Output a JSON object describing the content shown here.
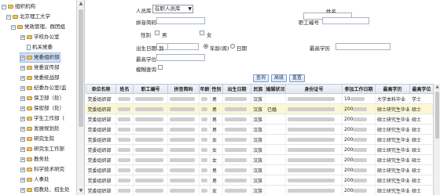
{
  "tree": {
    "root": "组织机构",
    "school": "北京理工大学",
    "college": "党政管理、群团组",
    "items": [
      "学校办公室",
      "机关党委",
      "党委组织部",
      "党委宣传部",
      "党委统战部",
      "纪委办公室(监",
      "保卫部（处）",
      "保密部（处）",
      "学生工作部（",
      "发展规划处",
      "研究生院",
      "研究生工作部",
      "教务处",
      "科学技术研究",
      "人事处",
      "招教处、招生处"
    ],
    "selected_index": 2
  },
  "form": {
    "personnel_label": "人员库",
    "personnel_value": "在职人员库",
    "name_label": "姓名",
    "pinyin_label": "拼音简码",
    "staff_id_label": "职工编号",
    "gender_label": "性别",
    "gender_male": "男",
    "gender_female": "女",
    "birth_label": "出生日期",
    "to_label": "到",
    "year_month_option": "年龄(周)",
    "date_option": "日期",
    "degree_label": "最高学历",
    "highest_degree_label": "最高学位",
    "fuzzy_label": "模糊查询",
    "btn_query": "查询",
    "btn_advanced": "高级",
    "btn_reset": "重置"
  },
  "table": {
    "headers": [
      "单位名称",
      "姓名",
      "职工编号",
      "拼音简码",
      "年龄",
      "性别",
      "出生日期",
      "民族",
      "婚姻状况",
      "身份证号",
      "参加工作日期",
      "最高学历",
      "最高学位"
    ],
    "rows": [
      {
        "unit": "党委组织部",
        "gender": "男",
        "ethnic": "汉族",
        "marital": "",
        "work": "19",
        "edu": "大学本科毕业",
        "deg": "学士",
        "hl": false
      },
      {
        "unit": "党委组织部",
        "gender": "男",
        "ethnic": "汉族",
        "marital": "已婚",
        "work": "200",
        "edu": "硕士研究生毕业",
        "deg": "硕士",
        "hl": true
      },
      {
        "unit": "党委组织部",
        "gender": "男",
        "ethnic": "汉族",
        "marital": "",
        "work": "200",
        "edu": "硕士研究生毕业",
        "deg": "硕士",
        "hl": false
      },
      {
        "unit": "党委组织部",
        "gender": "男",
        "ethnic": "汉族",
        "marital": "",
        "work": "200",
        "edu": "硕士研究生毕业",
        "deg": "硕士",
        "hl": false
      },
      {
        "unit": "党委组织部",
        "gender": "女",
        "ethnic": "汉族",
        "marital": "",
        "work": "200",
        "edu": "硕士研究生毕业",
        "deg": "硕士",
        "hl": false
      },
      {
        "unit": "党委组织部",
        "gender": "女",
        "ethnic": "汉族",
        "marital": "",
        "work": "200",
        "edu": "硕士研究生毕业",
        "deg": "硕士",
        "hl": false
      },
      {
        "unit": "党委组织部",
        "gender": "女",
        "ethnic": "汉族",
        "marital": "",
        "work": "200",
        "edu": "硕士研究生毕业",
        "deg": "硕士",
        "hl": false
      },
      {
        "unit": "党委组织部",
        "gender": "男",
        "ethnic": "汉族",
        "marital": "",
        "work": "200",
        "edu": "硕士研究生毕业",
        "deg": "硕士",
        "hl": false
      },
      {
        "unit": "党委组织部",
        "gender": "男",
        "ethnic": "汉族",
        "marital": "",
        "work": "200",
        "edu": "硕士研究生毕业",
        "deg": "硕士",
        "hl": false
      },
      {
        "unit": "党委组织部",
        "gender": "女",
        "ethnic": "汉族",
        "marital": "",
        "work": "200",
        "edu": "硕士研究生毕业",
        "deg": "硕士",
        "hl": false
      }
    ]
  }
}
